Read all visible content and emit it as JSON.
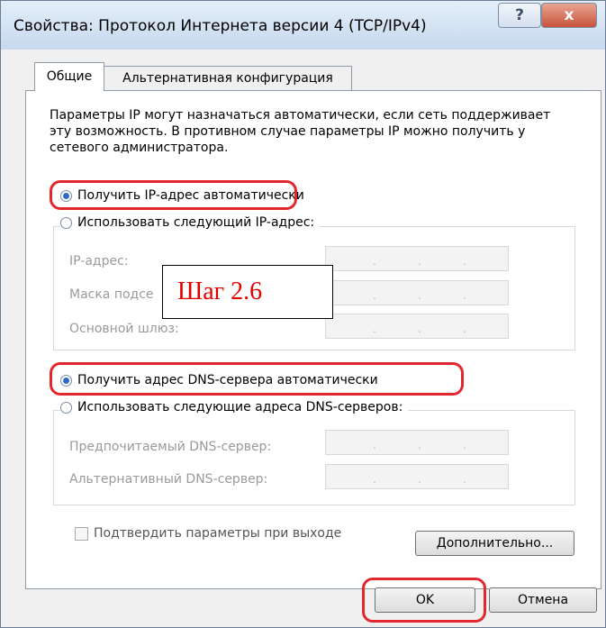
{
  "window": {
    "title": "Свойства: Протокол Интернета версии 4 (TCP/IPv4)",
    "help_glyph": "?",
    "close_glyph": "x"
  },
  "tabs": [
    {
      "label": "Общие",
      "active": true
    },
    {
      "label": "Альтернативная конфигурация",
      "active": false
    }
  ],
  "description": "Параметры IP могут назначаться автоматически, если сеть поддерживает эту возможность. В противном случае параметры IP можно получить у сетевого администратора.",
  "ip_section": {
    "auto_label": "Получить IP-адрес автоматически",
    "auto_selected": true,
    "manual_label": "Использовать следующий IP-адрес:",
    "fields": [
      {
        "label": "IP-адрес:"
      },
      {
        "label": "Маска подсе"
      },
      {
        "label": "Основной шлюз:"
      }
    ]
  },
  "callout": {
    "text": "Шаг 2.6"
  },
  "dns_section": {
    "auto_label": "Получить адрес DNS-сервера автоматически",
    "auto_selected": true,
    "manual_label": "Использовать следующие адреса DNS-серверов:",
    "fields": [
      {
        "label": "Предпочитаемый DNS-сервер:"
      },
      {
        "label": "Альтернативный DNS-сервер:"
      }
    ]
  },
  "validate_checkbox": {
    "label": "Подтвердить параметры при выходе",
    "checked": false
  },
  "buttons": {
    "advanced": "Дополнительно...",
    "ok": "OK",
    "cancel": "Отмена"
  },
  "highlight_color": "#e0282e"
}
